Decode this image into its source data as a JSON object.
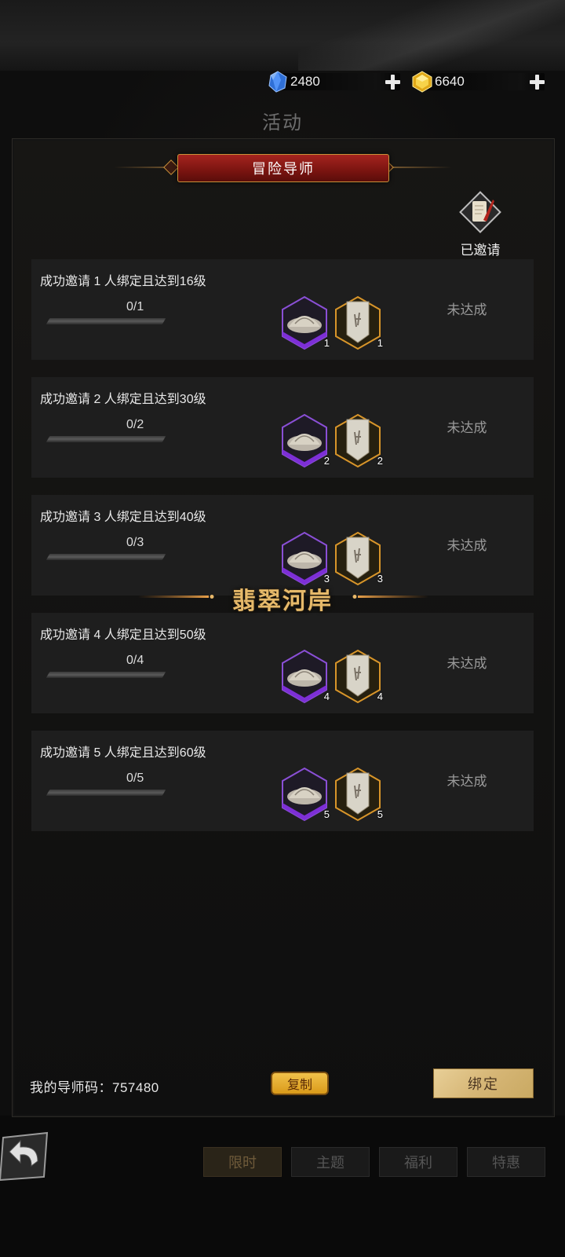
{
  "page_title": "活动",
  "currency": [
    {
      "name": "diamond",
      "amount": "2480",
      "icon": "blue-gem-icon",
      "color": "#3a7bd5"
    },
    {
      "name": "gold",
      "amount": "6640",
      "icon": "gold-gem-icon",
      "color": "#e6b422"
    }
  ],
  "section_title": "冒险导师",
  "invited": {
    "label": "已邀请",
    "icon": "scroll-quill-icon"
  },
  "tasks": [
    {
      "title": "成功邀请 1 人绑定且达到16级",
      "progress": "0/1",
      "progress_fraction": 0,
      "reward1_count": "1",
      "reward2_count": "1",
      "status": "未达成"
    },
    {
      "title": "成功邀请 2 人绑定且达到30级",
      "progress": "0/2",
      "progress_fraction": 0,
      "reward1_count": "2",
      "reward2_count": "2",
      "status": "未达成"
    },
    {
      "title": "成功邀请 3 人绑定且达到40级",
      "progress": "0/3",
      "progress_fraction": 0,
      "reward1_count": "3",
      "reward2_count": "3",
      "status": "未达成"
    },
    {
      "title": "成功邀请 4 人绑定且达到50级",
      "progress": "0/4",
      "progress_fraction": 0,
      "reward1_count": "4",
      "reward2_count": "4",
      "status": "未达成"
    },
    {
      "title": "成功邀请 5 人绑定且达到60级",
      "progress": "0/5",
      "progress_fraction": 0,
      "reward1_count": "5",
      "reward2_count": "5",
      "status": "未达成"
    }
  ],
  "rewards": {
    "reward1_icon": "stone-pile-icon",
    "reward1_frame": "purple",
    "reward2_icon": "banner-card-icon",
    "reward2_frame": "gold"
  },
  "overlay_text": "翡翠河岸",
  "mentor_code_label": "我的导师码：757480",
  "copy_label": "复制",
  "bind_label": "绑定",
  "tabs": [
    {
      "label": "限时",
      "active": true
    },
    {
      "label": "主题",
      "active": false
    },
    {
      "label": "福利",
      "active": false
    },
    {
      "label": "特惠",
      "active": false
    }
  ]
}
